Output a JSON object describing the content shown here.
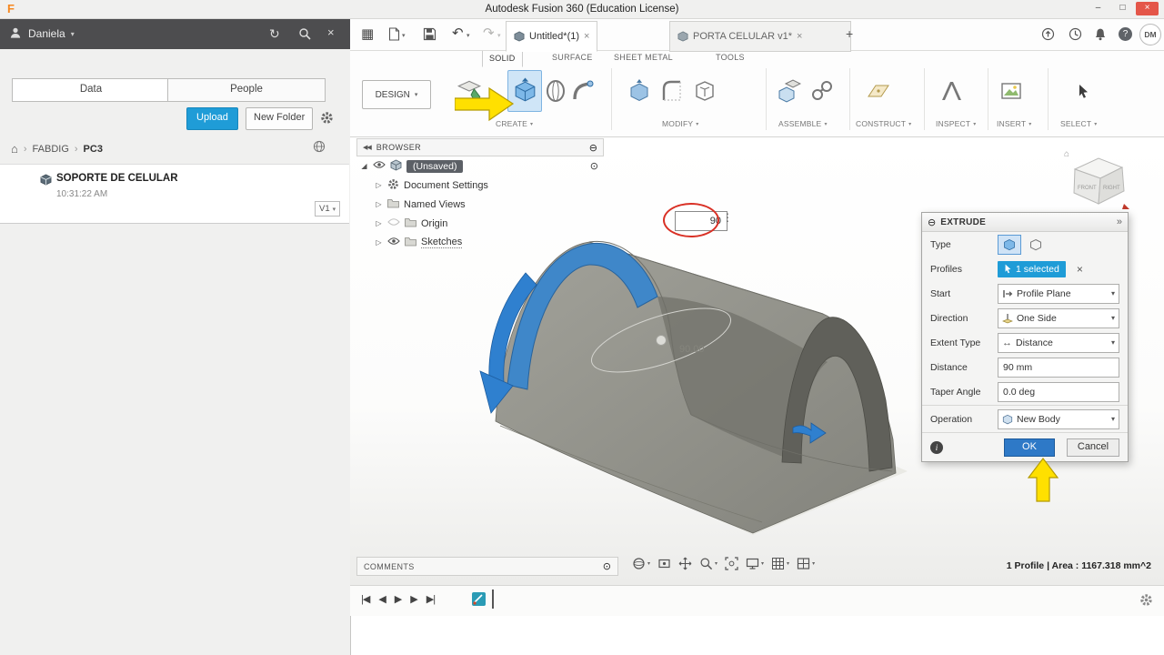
{
  "colors": {
    "accent_blue": "#0696d7",
    "selection_blue": "#3f87c9",
    "annotation_yellow": "#ffe000",
    "annotation_red": "#d93025"
  },
  "icons": {
    "dropdown": "▾",
    "chevron": "▷",
    "expanded": "◢",
    "close": "×",
    "plus": "+",
    "home": "⌂",
    "crumb_sep": "›",
    "refresh": "↻",
    "undo": "↶",
    "redo": "↷",
    "menu_grid": "▦",
    "kebab": "⋮",
    "minimize": "–",
    "maximize": "□",
    "collapse_circle": "⊖",
    "radio_circle": "⊙",
    "double_arrow": "»",
    "browser_collapse": "◀◀",
    "help": "?",
    "info": "i",
    "extent_arrows": "↔",
    "skip_start": "|◀",
    "step_back": "◀",
    "play": "▶",
    "step_fwd": "▶",
    "skip_end": "▶|"
  },
  "titlebar": {
    "logo": "F",
    "title": "Autodesk Fusion 360 (Education License)"
  },
  "data_panel": {
    "user_name": "Daniela",
    "tabs": [
      {
        "label": "Data"
      },
      {
        "label": "People"
      }
    ],
    "upload_label": "Upload",
    "new_folder_label": "New Folder",
    "breadcrumb": {
      "parent": "FABDIG",
      "current": "PC3"
    },
    "file": {
      "name": "SOPORTE DE CELULAR",
      "time": "10:31:22 AM",
      "version": "V1"
    }
  },
  "app_toolbar": {
    "doc_tabs": [
      {
        "label": "Untitled*(1)"
      },
      {
        "label": "PORTA CELULAR v1*"
      }
    ],
    "avatar_initials": "DM"
  },
  "ribbon": {
    "design_label": "DESIGN",
    "context_tabs": [
      "SOLID",
      "SURFACE",
      "SHEET METAL",
      "TOOLS"
    ],
    "group_labels": [
      "CREATE",
      "MODIFY",
      "ASSEMBLE",
      "CONSTRUCT",
      "INSPECT",
      "INSERT",
      "SELECT"
    ]
  },
  "browser": {
    "title": "BROWSER",
    "root_label": "(Unsaved)",
    "items": [
      {
        "label": "Document Settings"
      },
      {
        "label": "Named Views"
      },
      {
        "label": "Origin"
      },
      {
        "label": "Sketches"
      }
    ]
  },
  "viewport": {
    "dimension_input": "90",
    "dimension_label": "90.00",
    "viewcube_front": "FRONT",
    "viewcube_right": "RIGHT"
  },
  "extrude_dialog": {
    "title": "EXTRUDE",
    "type_label": "Type",
    "profiles_label": "Profiles",
    "profiles_value": "1 selected",
    "start_label": "Start",
    "start_value": "Profile Plane",
    "direction_label": "Direction",
    "direction_value": "One Side",
    "extent_label": "Extent Type",
    "extent_value": "Distance",
    "distance_label": "Distance",
    "distance_value": "90 mm",
    "taper_label": "Taper Angle",
    "taper_value": "0.0 deg",
    "operation_label": "Operation",
    "operation_value": "New Body",
    "ok": "OK",
    "cancel": "Cancel"
  },
  "bottom_bar": {
    "comments_label": "COMMENTS",
    "status_text": "1 Profile | Area : 1167.318 mm^2"
  }
}
